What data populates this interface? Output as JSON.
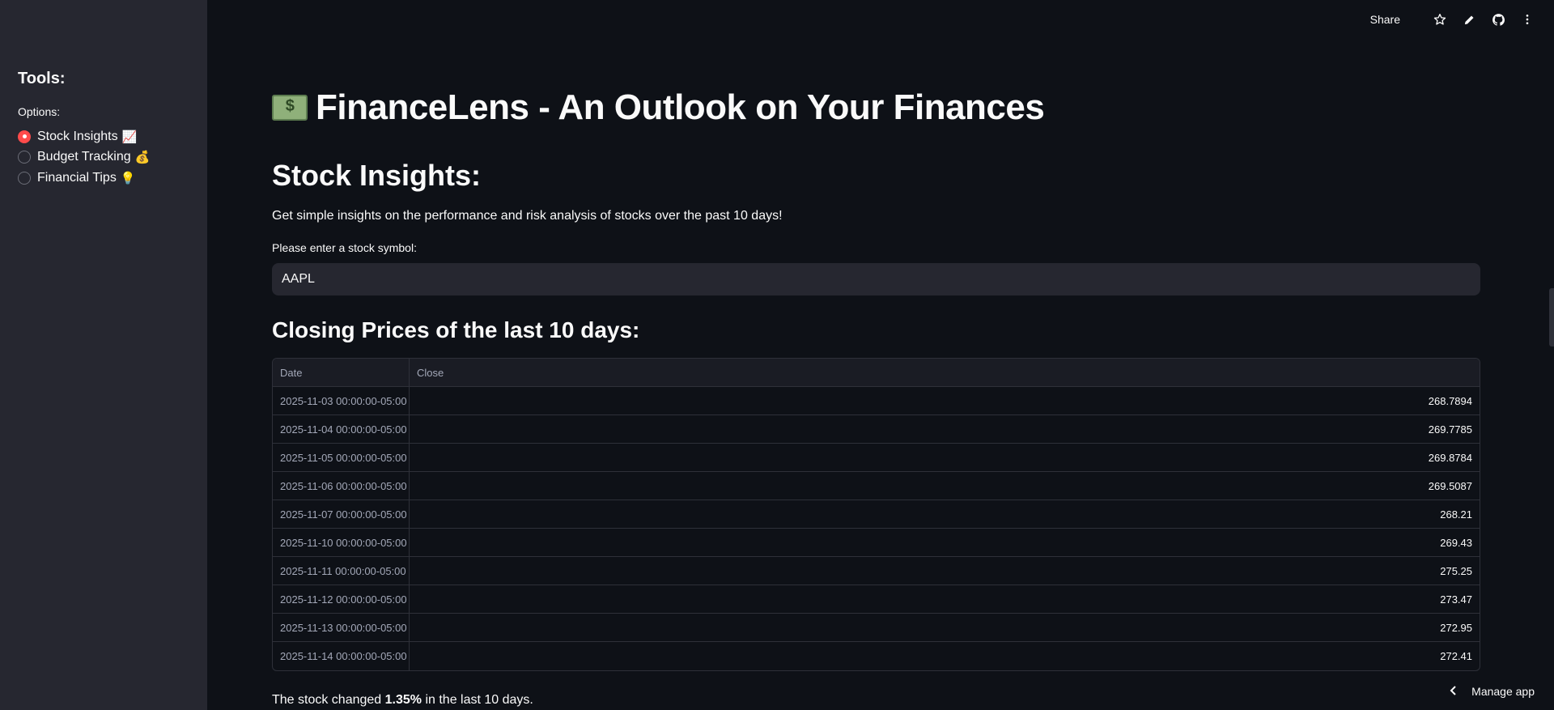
{
  "sidebar": {
    "title": "Tools:",
    "options_label": "Options:",
    "options": [
      {
        "label": "Stock Insights",
        "emoji": "📈",
        "selected": true
      },
      {
        "label": "Budget Tracking",
        "emoji": "💰",
        "selected": false
      },
      {
        "label": "Financial Tips",
        "emoji": "💡",
        "selected": false
      }
    ]
  },
  "toolbar": {
    "share_label": "Share",
    "icons": [
      "star-icon",
      "edit-icon",
      "github-icon",
      "more-vertical-icon"
    ]
  },
  "main": {
    "page_title": "FinanceLens - An Outlook on Your Finances",
    "section_title": "Stock Insights:",
    "description": "Get simple insights on the performance and risk analysis of stocks over the past 10 days!",
    "input_label": "Please enter a stock symbol:",
    "input_value": "AAPL",
    "table_title": "Closing Prices of the last 10 days:",
    "table": {
      "columns": [
        "Date",
        "Close"
      ],
      "rows": [
        [
          "2025-11-03 00:00:00-05:00",
          "268.7894"
        ],
        [
          "2025-11-04 00:00:00-05:00",
          "269.7785"
        ],
        [
          "2025-11-05 00:00:00-05:00",
          "269.8784"
        ],
        [
          "2025-11-06 00:00:00-05:00",
          "269.5087"
        ],
        [
          "2025-11-07 00:00:00-05:00",
          "268.21"
        ],
        [
          "2025-11-10 00:00:00-05:00",
          "269.43"
        ],
        [
          "2025-11-11 00:00:00-05:00",
          "275.25"
        ],
        [
          "2025-11-12 00:00:00-05:00",
          "273.47"
        ],
        [
          "2025-11-13 00:00:00-05:00",
          "272.95"
        ],
        [
          "2025-11-14 00:00:00-05:00",
          "272.41"
        ]
      ]
    },
    "summary_prefix": "The stock changed ",
    "summary_value": "1.35%",
    "summary_suffix": " in the last 10 days."
  },
  "footer": {
    "manage_label": "Manage app"
  },
  "colors": {
    "accent": "#ff4b4b",
    "background": "#0e1117",
    "sidebar": "#262730"
  }
}
